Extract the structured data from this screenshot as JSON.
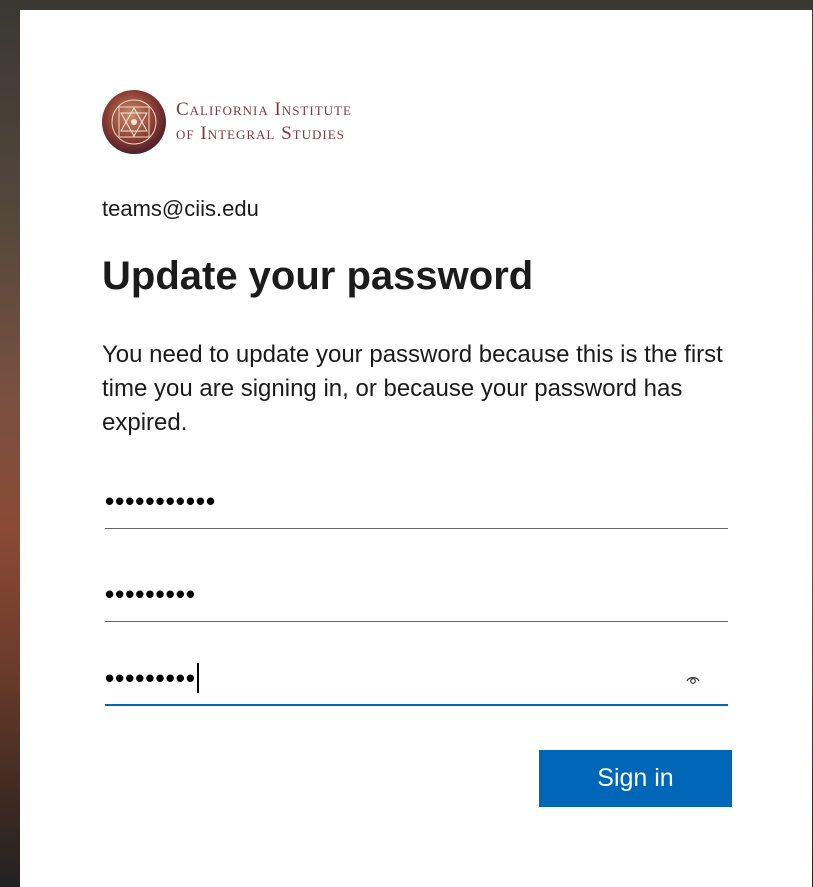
{
  "org": {
    "logo_line1": "California Institute",
    "logo_line2": "of Integral Studies"
  },
  "account_email": "teams@ciis.edu",
  "page_title": "Update your password",
  "description": "You need to update your password because this is the first time you are signing in, or because your password has expired.",
  "fields": [
    {
      "name": "current-password",
      "value": "•••••••••••"
    },
    {
      "name": "new-password",
      "value": "•••••••••"
    },
    {
      "name": "confirm-password",
      "value": "•••••••••",
      "focused": true
    }
  ],
  "icons": {
    "reveal": "eye-icon",
    "logo": "yantra-seal-icon"
  },
  "colors": {
    "accent": "#0067b8",
    "logo_text": "#7a3b47"
  },
  "signin_label": "Sign in"
}
